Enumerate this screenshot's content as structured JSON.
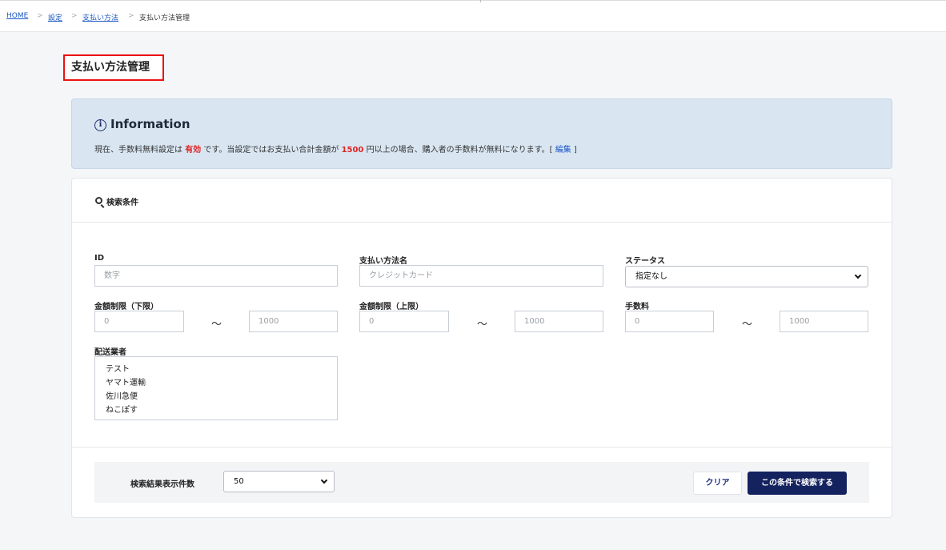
{
  "breadcrumb": {
    "items": [
      "HOME",
      "設定",
      "支払い方法",
      "支払い方法管理"
    ],
    "separator": ">"
  },
  "page": {
    "title": "支払い方法管理"
  },
  "info": {
    "title": "Information",
    "text_1": "現在、手数料無料設定は",
    "status": "有効",
    "text_2": "です。当設定ではお支払い合計金額が",
    "amount": "1500",
    "text_3": "円以上の場合、購入者の手数料が無料になります。[",
    "edit_label": "編集",
    "text_4": "]"
  },
  "search": {
    "title": "検索条件",
    "id": {
      "label": "ID",
      "placeholder": "数字"
    },
    "method_name": {
      "label": "支払い方法名",
      "placeholder": "クレジットカード"
    },
    "status": {
      "label": "ステータス",
      "selected": "指定なし"
    },
    "amount_min": {
      "label": "金額制限（下限）",
      "from_placeholder": "0",
      "to_placeholder": "1000"
    },
    "amount_max": {
      "label": "金額制限（上限）",
      "from_placeholder": "0",
      "to_placeholder": "1000"
    },
    "fee": {
      "label": "手数料",
      "from_placeholder": "0",
      "to_placeholder": "1000"
    },
    "range_separator": "～",
    "delivery": {
      "label": "配送業者",
      "options": [
        "テスト",
        "ヤマト運輸",
        "佐川急便",
        "ねこぽす"
      ]
    }
  },
  "footer": {
    "result_count_label": "検索結果表示件数",
    "result_count": "50",
    "clear_label": "クリア",
    "search_label": "この条件で検索する"
  },
  "colors": {
    "accent": "#14225f",
    "link": "#1a56c4",
    "highlight": "#e02424",
    "info_bg": "#d9e6f2",
    "title_border": "#e11111"
  },
  "icons": [
    "info-icon",
    "search-icon",
    "chevron-down-icon"
  ]
}
